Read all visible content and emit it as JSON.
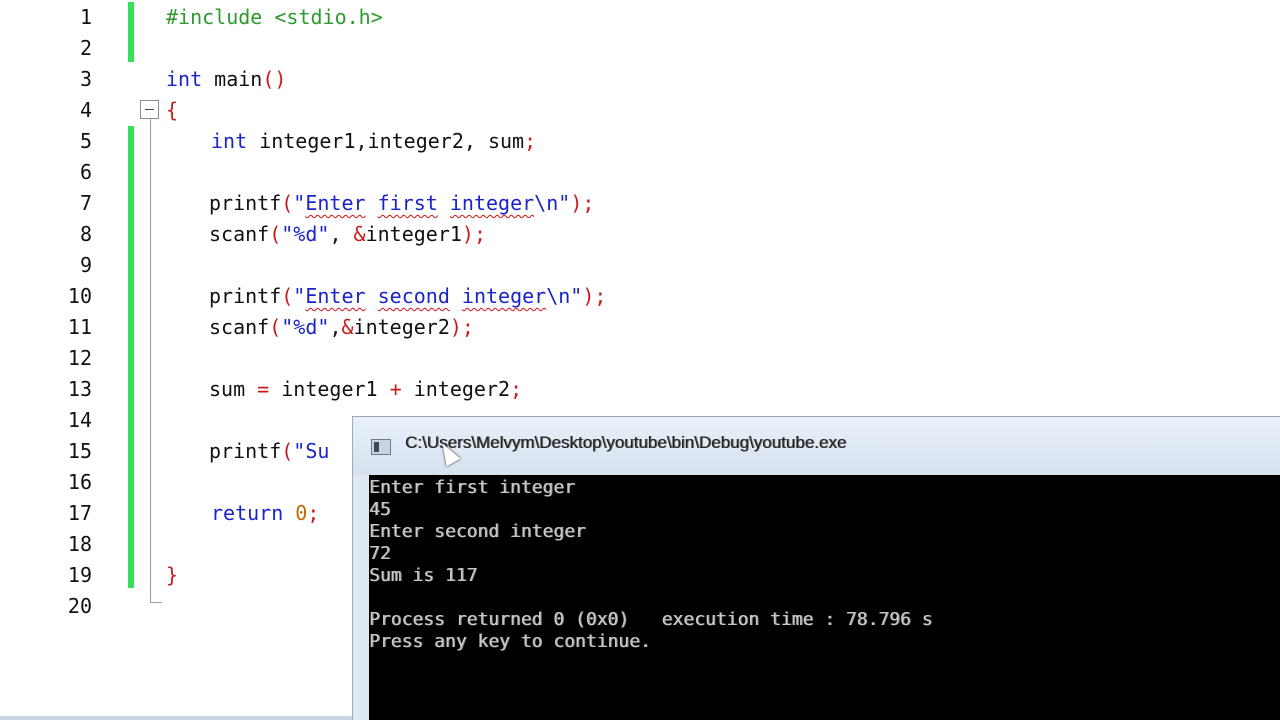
{
  "editor": {
    "line_numbers": [
      "1",
      "2",
      "3",
      "4",
      "5",
      "6",
      "7",
      "8",
      "9",
      "10",
      "11",
      "12",
      "13",
      "14",
      "15",
      "16",
      "17",
      "18",
      "19",
      "20"
    ],
    "lines": {
      "l1": {
        "pp": "#include <stdio.h>"
      },
      "l3": {
        "kw": "int",
        "rest": " main",
        "paren": "()"
      },
      "l4": {
        "brace": "{"
      },
      "l5": {
        "kw": "int",
        "rest": " integer1,integer2, sum",
        "semi": ";"
      },
      "l7": {
        "fn": "printf",
        "open": "(",
        "q1": "\"",
        "w1": "Enter",
        "s1": " ",
        "w2": "first",
        "s2": " ",
        "w3": "integer",
        "esc": "\\n",
        "q2": "\"",
        "close": ");"
      },
      "l8": {
        "fn": "scanf",
        "open": "(",
        "str": "\"%d\"",
        "mid": ", ",
        "amp": "&",
        "var": "integer1",
        "close": ");"
      },
      "l10": {
        "fn": "printf",
        "open": "(",
        "q1": "\"",
        "w1": "Enter",
        "s1": " ",
        "w2": "second",
        "s2": " ",
        "w3": "integer",
        "esc": "\\n",
        "q2": "\"",
        "close": ");"
      },
      "l11": {
        "fn": "scanf",
        "open": "(",
        "str": "\"%d\"",
        "mid": ",",
        "amp": "&",
        "var": "integer2",
        "close": ");"
      },
      "l13": {
        "a": "sum ",
        "eq": "=",
        "b": " integer1 ",
        "plus": "+",
        "c": " integer2",
        "semi": ";"
      },
      "l15": {
        "fn": "printf",
        "open": "(",
        "str": "\"Su"
      },
      "l17": {
        "kw": "return",
        "sp": " ",
        "num": "0",
        "semi": ";"
      },
      "l19": {
        "brace": "}"
      }
    }
  },
  "console": {
    "title": "C:\\Users\\Melvym\\Desktop\\youtube\\bin\\Debug\\youtube.exe",
    "output": [
      "Enter first integer",
      "45",
      "Enter second integer",
      "72",
      "Sum is 117",
      "",
      "Process returned 0 (0x0)   execution time : 78.796 s",
      "Press any key to continue."
    ]
  },
  "icons": [
    "fold-collapse-icon",
    "console-window-icon",
    "mouse-cursor-icon"
  ],
  "colors": {
    "keyword": "#1a24c8",
    "preprocessor": "#2d9a2d",
    "operator": "#cc1a1a",
    "number": "#c46a00",
    "change_bar": "#36e05a",
    "console_bg": "#000000"
  }
}
